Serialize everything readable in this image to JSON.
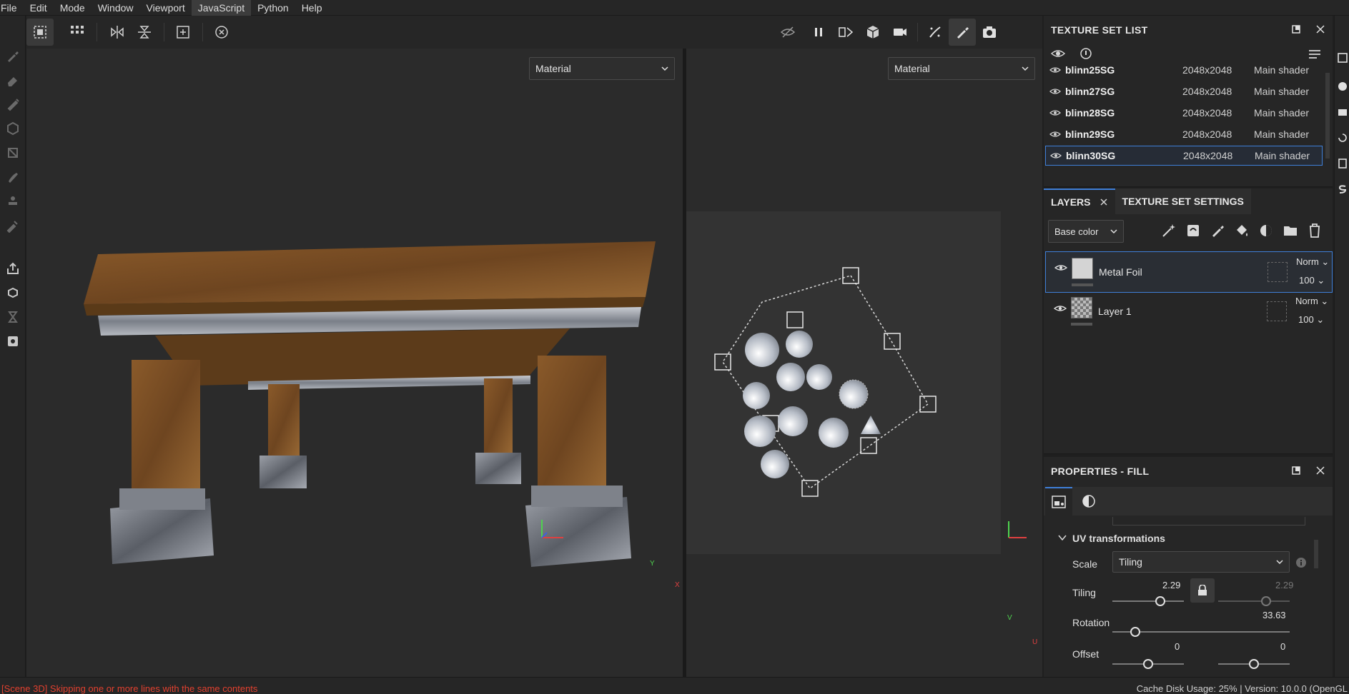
{
  "menu": [
    "File",
    "Edit",
    "Mode",
    "Window",
    "Viewport",
    "JavaScript",
    "Python",
    "Help"
  ],
  "viewport3d": {
    "material_select": "Material",
    "axis_y": "Y",
    "axis_x": "X"
  },
  "viewport2d": {
    "material_select": "Material",
    "axis_v": "V",
    "axis_u": "U"
  },
  "texture_set_list": {
    "title": "TEXTURE SET LIST",
    "rows": [
      {
        "name": "blinn25SG",
        "res": "2048x2048",
        "shader": "Main shader"
      },
      {
        "name": "blinn27SG",
        "res": "2048x2048",
        "shader": "Main shader"
      },
      {
        "name": "blinn28SG",
        "res": "2048x2048",
        "shader": "Main shader"
      },
      {
        "name": "blinn29SG",
        "res": "2048x2048",
        "shader": "Main shader"
      },
      {
        "name": "blinn30SG",
        "res": "2048x2048",
        "shader": "Main shader"
      }
    ]
  },
  "layers_panel": {
    "tab_layers": "LAYERS",
    "tab_settings": "TEXTURE SET SETTINGS",
    "channel_select": "Base color",
    "layers": [
      {
        "name": "Metal Foil",
        "blend": "Norm",
        "opacity": "100"
      },
      {
        "name": "Layer 1",
        "blend": "Norm",
        "opacity": "100"
      }
    ]
  },
  "properties": {
    "title": "PROPERTIES - FILL",
    "section": "UV transformations",
    "scale_label": "Scale",
    "scale_value": "Tiling",
    "tiling_label": "Tiling",
    "tiling_u": "2.29",
    "tiling_v": "2.29",
    "rotation_label": "Rotation",
    "rotation_value": "33.63",
    "offset_label": "Offset",
    "offset_u": "0",
    "offset_v": "0"
  },
  "status": {
    "left": "[Scene 3D] Skipping one or more lines with the same contents",
    "right": "Cache Disk Usage:  25% | Version: 10.0.0 (OpenGL"
  },
  "colors": {
    "accent": "#3f7fd8",
    "error": "#e0402f"
  }
}
